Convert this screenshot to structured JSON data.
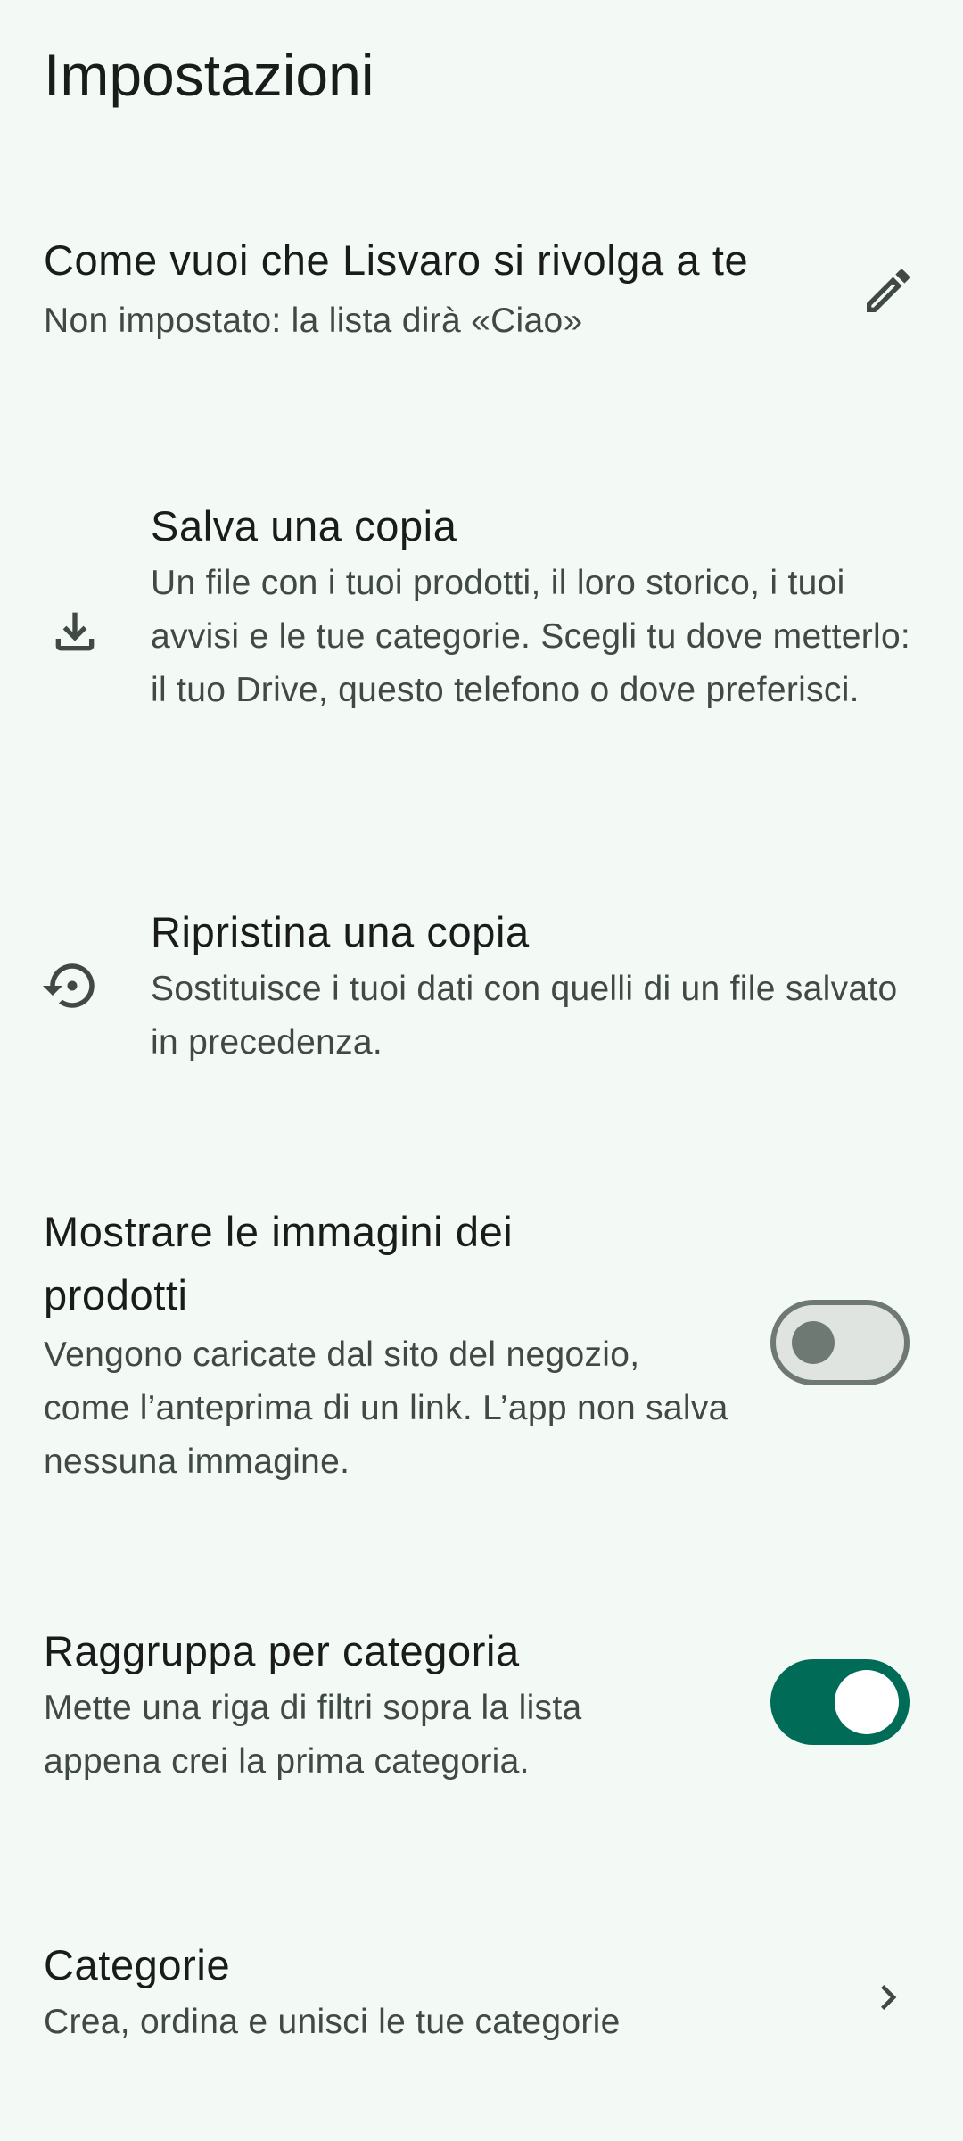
{
  "header": {
    "title": "Impostazioni"
  },
  "settings": {
    "greeting": {
      "title": "Come vuoi che Lisvaro si rivolga a te",
      "subtitle": "Non impostato: la lista dirà «Ciao»",
      "icon": "edit-pencil-icon"
    },
    "save_copy": {
      "title": "Salva una copia",
      "subtitle": "Un file con i tuoi prodotti, il loro storico, i tuoi avvisi e le tue categorie. Scegli tu dove metterlo: il tuo Drive, questo telefono o dove preferisci.",
      "icon": "download-icon"
    },
    "restore_copy": {
      "title": "Ripristina una copia",
      "subtitle": "Sostituisce i tuoi dati con quelli di un file salvato in precedenza.",
      "icon": "restore-history-icon"
    },
    "product_images": {
      "title_line1": "Mostrare le immagini dei",
      "title_line2": "prodotti",
      "subtitle": "Vengono caricate dal sito del negozio, come l’anteprima di un link. L’app non salva nessuna immagine.",
      "enabled": false
    },
    "group_by_category": {
      "title": "Raggruppa per categoria",
      "subtitle": "Mette una riga di filtri sopra la lista appena crei la prima categoria.",
      "enabled": true
    },
    "categories": {
      "title": "Categorie",
      "subtitle": "Crea, ordina e unisci le tue categorie",
      "icon": "chevron-right-icon"
    }
  },
  "colors": {
    "background": "#f3f9f5",
    "accent": "#006c57",
    "icon": "#404944",
    "switch_off_track": "#dfe4e0",
    "switch_off_outline": "#6f7973"
  }
}
